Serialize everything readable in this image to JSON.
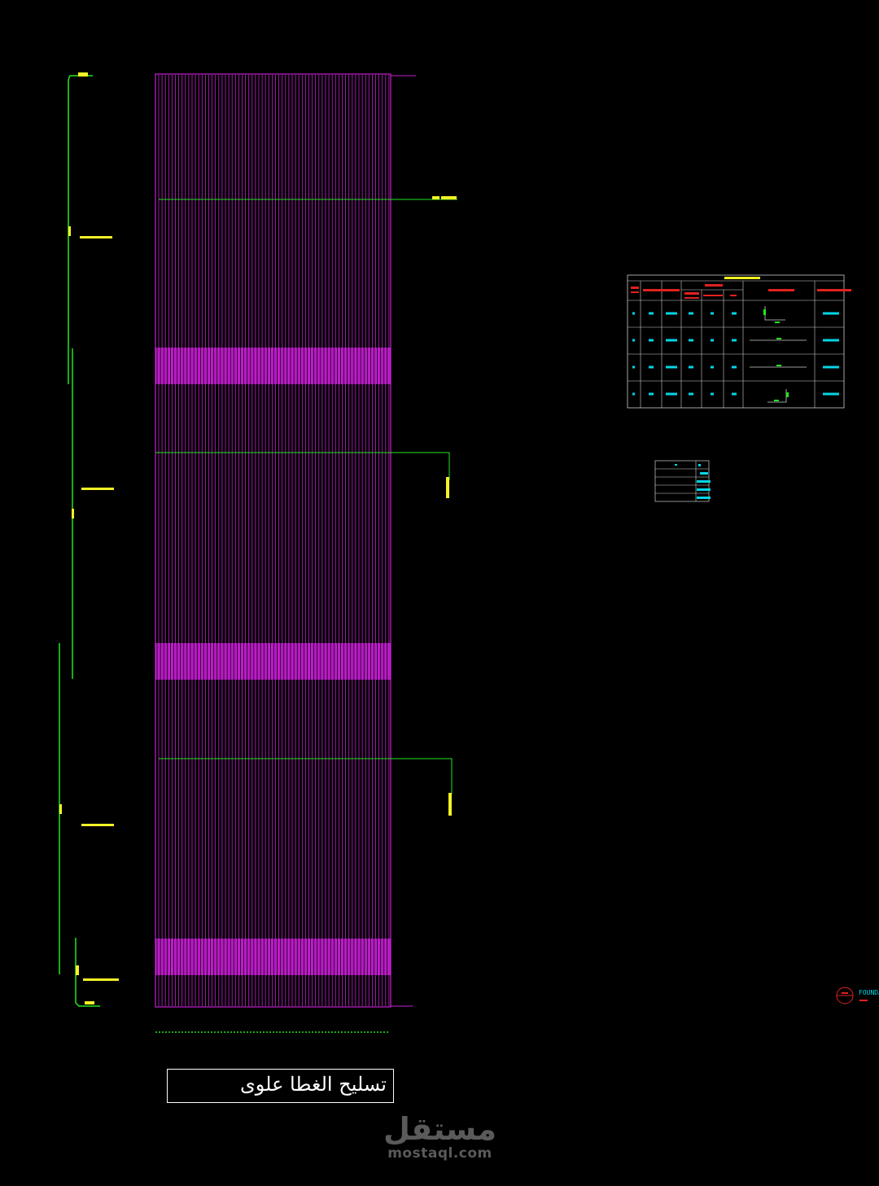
{
  "drawing": {
    "title": "تسليح الغطا علوى",
    "foundation_label": "FOUNDA"
  },
  "watermark": {
    "arabic": "مستقل",
    "latin": "mostaql.com"
  },
  "colors": {
    "background": "#000000",
    "rebar": "#c61fd0",
    "rebar_dense": "#d21ee0",
    "dimension": "#22e51f",
    "label": "#f3f325",
    "table_grid": "#cfcfcf",
    "table_header": "#e0221f",
    "table_text": "#00d6e6",
    "title": "#ffffff",
    "watermark": "#5a5a5a"
  },
  "schedule_table": {
    "header_icon": "label-bar",
    "rows": 4
  },
  "summary_table": {
    "rows": 5
  }
}
